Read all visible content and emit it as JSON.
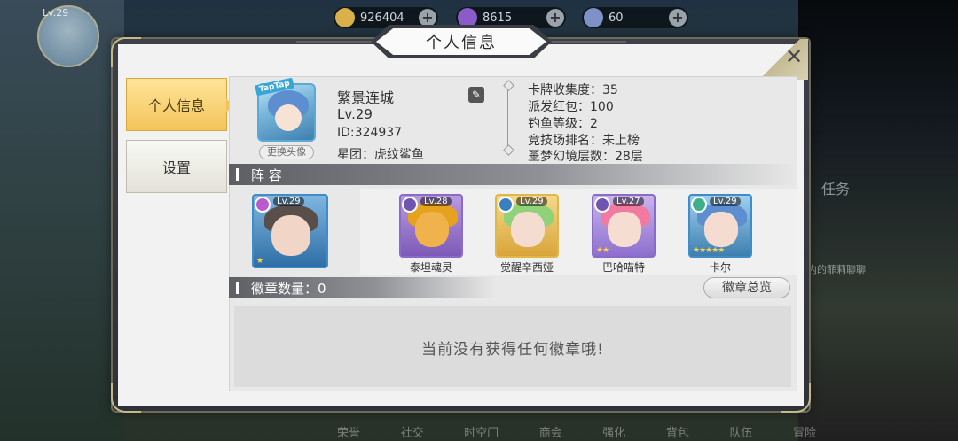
{
  "hud": {
    "player_level": "Lv.29",
    "resources": [
      {
        "name": "gold",
        "icon": "coin-icon",
        "value": "926404",
        "color": "#d9b04a"
      },
      {
        "name": "gems",
        "icon": "crystal-icon",
        "value": "8615",
        "color": "#8b5cc9"
      },
      {
        "name": "energy",
        "icon": "orb-icon",
        "value": "60",
        "color": "#7e92c8"
      }
    ],
    "bottom_nav": [
      "荣誉",
      "社交",
      "时空门",
      "商会",
      "强化",
      "背包",
      "队伍",
      "冒险"
    ],
    "side_texts": [
      "任务",
      "内的菲莉聊聊"
    ]
  },
  "modal": {
    "title": "个人信息",
    "tabs": [
      {
        "label": "个人信息",
        "active": true
      },
      {
        "label": "设置",
        "active": false
      }
    ],
    "profile": {
      "avatar_tag": "TapTap",
      "change_avatar_label": "更换头像",
      "name": "繁景连城",
      "level": "Lv.29",
      "id": "ID:324937",
      "guild": "星团：虎纹鲨鱼"
    },
    "stats": [
      "卡牌收集度：35",
      "派发红包：100",
      "钓鱼等级：2",
      "竞技场排名：未上榜",
      "噩梦幻境层数：28层"
    ],
    "lineup": {
      "header": "阵 容",
      "leader": {
        "level": "Lv.29",
        "stars": 1
      },
      "members": [
        {
          "name": "泰坦魂灵",
          "level": "Lv.28",
          "stars": 0,
          "frame": "#8a6bc9",
          "hair": "#e6a21d",
          "skin": "#f0b24a"
        },
        {
          "name": "觉醒辛西娅",
          "level": "Lv.29",
          "stars": 0,
          "frame": "#e0b84a",
          "hair": "#8fd27a",
          "skin": "#f4dcd0"
        },
        {
          "name": "巴哈喵特",
          "level": "Lv.27",
          "stars": 2,
          "frame": "#8a6bc9",
          "hair": "#f27aa0",
          "skin": "#f6ddd2"
        },
        {
          "name": "卡尔",
          "level": "Lv.29",
          "stars": 5,
          "frame": "#3e8cc8",
          "hair": "#5d8fd0",
          "skin": "#f4dcd0"
        }
      ]
    },
    "badges": {
      "count_label": "徽章数量：0",
      "total_button": "徽章总览",
      "empty_message": "当前没有获得任何徽章哦!"
    }
  }
}
